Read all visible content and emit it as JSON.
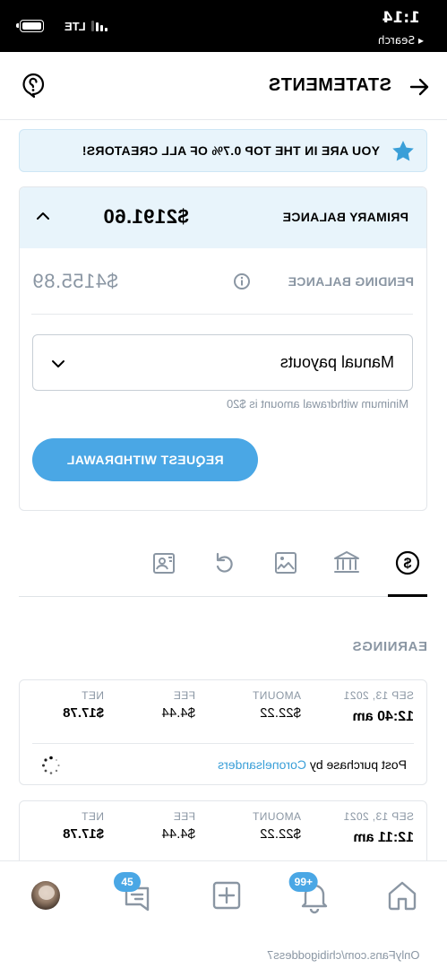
{
  "status_bar": {
    "time": "1:14",
    "back_label": "◂ Search",
    "network": "LTE"
  },
  "header": {
    "title": "STATEMENTS",
    "back_icon": "arrow-left-icon",
    "help_icon": "help-icon"
  },
  "banner": {
    "text": "YOU ARE IN THE TOP 0.7% OF ALL CREATORS!",
    "icon": "star-icon"
  },
  "balance": {
    "primary_label": "PRIMARY BALANCE",
    "primary_amount": "$2191.60",
    "pending_label": "PENDING BALANCE",
    "pending_amount": "$4155.89",
    "payout_mode": "Manual payouts",
    "min_note": "Minimum withdrawal amount is $20",
    "request_button": "REQUEST WITHDRAWAL"
  },
  "tabs": [
    {
      "icon": "dollar-icon",
      "active": true
    },
    {
      "icon": "bank-icon",
      "active": false
    },
    {
      "icon": "image-icon",
      "active": false
    },
    {
      "icon": "refund-icon",
      "active": false
    },
    {
      "icon": "user-card-icon",
      "active": false
    }
  ],
  "earnings": {
    "title": "EARNINGS",
    "headers": {
      "date": "SEP 13, 2021",
      "amount": "AMOUNT",
      "fee": "FEE",
      "net": "NET"
    },
    "items": [
      {
        "date": "SEP 13, 2021",
        "time": "12:40 am",
        "amount": "$22.22",
        "fee": "$4.44",
        "net": "$17.78",
        "desc_prefix": "Post purchase by ",
        "user": "Coronelsanders"
      },
      {
        "date": "SEP 13, 2021",
        "time": "12:11 am",
        "amount": "$22.22",
        "fee": "$4.44",
        "net": "$17.78"
      }
    ]
  },
  "bottom_nav": {
    "home_icon": "home-icon",
    "notifications_badge": "99+",
    "add_icon": "plus-square-icon",
    "messages_badge": "45",
    "avatar": "avatar"
  },
  "url": "OnlyFans.com/chibigoddess7",
  "colors": {
    "accent": "#4aa7e5",
    "banner_bg": "#e8f4fb",
    "muted": "#8a96a3"
  }
}
